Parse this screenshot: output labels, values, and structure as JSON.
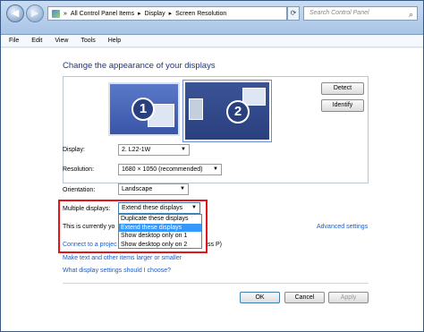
{
  "addressbar": {
    "back": "◀",
    "forward": "▶",
    "crumbs": [
      "All Control Panel Items",
      "Display",
      "Screen Resolution"
    ],
    "search_placeholder": "Search Control Panel"
  },
  "menu": [
    "File",
    "Edit",
    "View",
    "Tools",
    "Help"
  ],
  "main": {
    "heading": "Change the appearance of your displays",
    "monitor1": "1",
    "monitor2": "2",
    "detect": "Detect",
    "identify": "Identify",
    "display_label": "Display:",
    "display_value": "2. L22-1W",
    "resolution_label": "Resolution:",
    "resolution_value": "1680 × 1050 (recommended)",
    "orientation_label": "Orientation:",
    "orientation_value": "Landscape",
    "multiple_label": "Multiple displays:",
    "multiple_value": "Extend these displays",
    "options": [
      "Duplicate these displays",
      "Extend these displays",
      "Show desktop only on 1",
      "Show desktop only on 2"
    ],
    "selected_index": 1,
    "current_text": "This is currently yo",
    "advanced": "Advanced settings",
    "connect": "Connect to a projec",
    "connect_tail": "ss P)",
    "make_text": "Make text and other items larger or smaller",
    "what_settings": "What display settings should I choose?",
    "ok": "OK",
    "cancel": "Cancel",
    "apply": "Apply"
  }
}
